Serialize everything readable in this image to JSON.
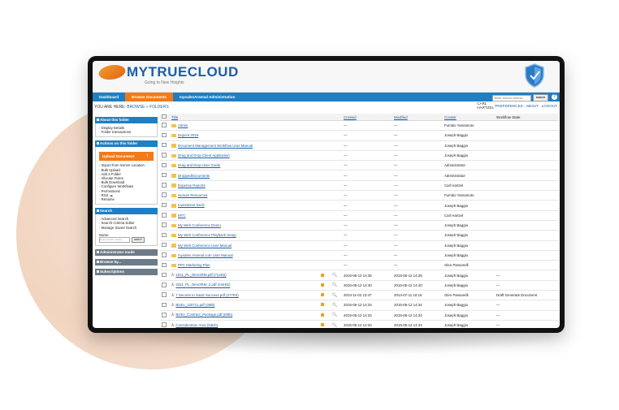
{
  "app": {
    "logo": "MYTRUECLOUD",
    "tagline": "Going to New Heights"
  },
  "nav": {
    "tabs": [
      "Dashboard",
      "Browse Documents",
      "mysalesArsenal Administration"
    ],
    "active_tab": 1,
    "search_placeholder": "Enter search criteria...",
    "search_button": "search",
    "help": "?"
  },
  "breadcrumb": {
    "prefix": "YOU ARE HERE:",
    "path": "BROWSE » FOLDERS"
  },
  "user": {
    "name": "CARL HARTZEL",
    "links": [
      "PREFERENCES",
      "ABOUT",
      "LOGOUT"
    ]
  },
  "sidebar": {
    "about_title": "About this folder",
    "about_items": [
      "Display Details",
      "Folder transactions"
    ],
    "actions_title": "Actions on this folder",
    "upload_label": "Upload Document",
    "actions_items": [
      "Import from Server Location",
      "Bulk Upload",
      "Add a Folder",
      "Allocate Roles",
      "Bulk Download",
      "Configure Workflows",
      "Permissions",
      "RSS",
      "Rename"
    ],
    "search_title": "Search",
    "search_items": [
      "Advanced Search",
      "Search Criteria Editor",
      "Manage Saved Search"
    ],
    "search_label": "Name",
    "search_placeholder": "Enter search criteria",
    "search_button": "search",
    "admin_title": "Administrator mode",
    "browse_title": "Browse by...",
    "subs_title": "Subscriptions"
  },
  "table": {
    "headers": [
      "Title",
      "Created",
      "Modified",
      "Creator",
      "Workflow State"
    ],
    "rows": [
      {
        "type": "folder",
        "title": "Admin",
        "created": "—",
        "modified": "—",
        "creator": "Fumiko Yamamoto",
        "state": ""
      },
      {
        "type": "folder",
        "title": "Dupont 2019",
        "created": "—",
        "modified": "—",
        "creator": "Joseph Baggio",
        "state": ""
      },
      {
        "type": "folder",
        "title": "Document Management Workflow User Manual",
        "created": "—",
        "modified": "—",
        "creator": "Joseph Baggio",
        "state": ""
      },
      {
        "type": "folder",
        "title": "Drag and Drop Client Application",
        "created": "—",
        "modified": "—",
        "creator": "Joseph Baggio",
        "state": ""
      },
      {
        "type": "folder",
        "title": "Drag and Drop User Guide",
        "created": "—",
        "modified": "—",
        "creator": "Administrator",
        "state": ""
      },
      {
        "type": "folder",
        "title": "DroppedDocuments",
        "created": "—",
        "modified": "—",
        "creator": "Administrator",
        "state": ""
      },
      {
        "type": "folder",
        "title": "Expense Reports",
        "created": "—",
        "modified": "—",
        "creator": "Carl Hartzel",
        "state": ""
      },
      {
        "type": "folder",
        "title": "Human Resources",
        "created": "—",
        "modified": "—",
        "creator": "Fumiko Yamamoto",
        "state": ""
      },
      {
        "type": "folder",
        "title": "Investment Deck",
        "created": "—",
        "modified": "—",
        "creator": "Joseph Baggio",
        "state": ""
      },
      {
        "type": "folder",
        "title": "MTC",
        "created": "—",
        "modified": "—",
        "creator": "Carl Hartzel",
        "state": ""
      },
      {
        "type": "folder",
        "title": "My Web Conference Demo",
        "created": "—",
        "modified": "—",
        "creator": "Joseph Baggio",
        "state": ""
      },
      {
        "type": "folder",
        "title": "My Web Conference Playback Setup",
        "created": "—",
        "modified": "—",
        "creator": "Joseph Baggio",
        "state": ""
      },
      {
        "type": "folder",
        "title": "My Web Conference User Manual",
        "created": "—",
        "modified": "—",
        "creator": "Joseph Baggio",
        "state": ""
      },
      {
        "type": "folder",
        "title": "mysales Arsenal.com User Manual",
        "created": "—",
        "modified": "—",
        "creator": "Joseph Baggio",
        "state": ""
      },
      {
        "type": "folder",
        "title": "PPC Marketing Plan",
        "created": "—",
        "modified": "—",
        "creator": "Glen Passarelli",
        "state": ""
      },
      {
        "type": "pdf",
        "title": "2011_PL_DirectRM.pdf (714Kb)",
        "created": "2015-06-12 14:35",
        "modified": "2015-06-12 14:35",
        "creator": "Joseph Baggio",
        "state": "—"
      },
      {
        "type": "pdf",
        "title": "2011_PL_DirectRM_2.pdf (444Kb)",
        "created": "2015-06-12 14:40",
        "modified": "2015-06-12 14:40",
        "creator": "Joseph Baggio",
        "state": "—"
      },
      {
        "type": "pdf",
        "title": "7 Secrets to SaaS Success.pdf (277Kb)",
        "created": "2013-11-02 13:47",
        "modified": "2014-07-11 10:16",
        "creator": "Glen Passarelli",
        "state": "Draft Generate Document"
      },
      {
        "type": "pdf",
        "title": "BizEx_120711.pdf (4Mb)",
        "created": "2015-06-12 14:34",
        "modified": "2015-06-12 14:34",
        "creator": "Joseph Baggio",
        "state": "—"
      },
      {
        "type": "pdf",
        "title": "BizEx_Contract_Package.pdf (8Mb)",
        "created": "2015-06-12 14:34",
        "modified": "2015-06-12 14:34",
        "creator": "Joseph Baggio",
        "state": "—"
      },
      {
        "type": "pdf",
        "title": "Consideration Area (53Kb)",
        "created": "2015-06-12 14:34",
        "modified": "2015-06-12 14:34",
        "creator": "Joseph Baggio",
        "state": "—"
      }
    ]
  },
  "colors": {
    "nav_blue": "#1e7fc3",
    "accent_orange": "#f27a1a",
    "link_blue": "#1e5d9c"
  }
}
